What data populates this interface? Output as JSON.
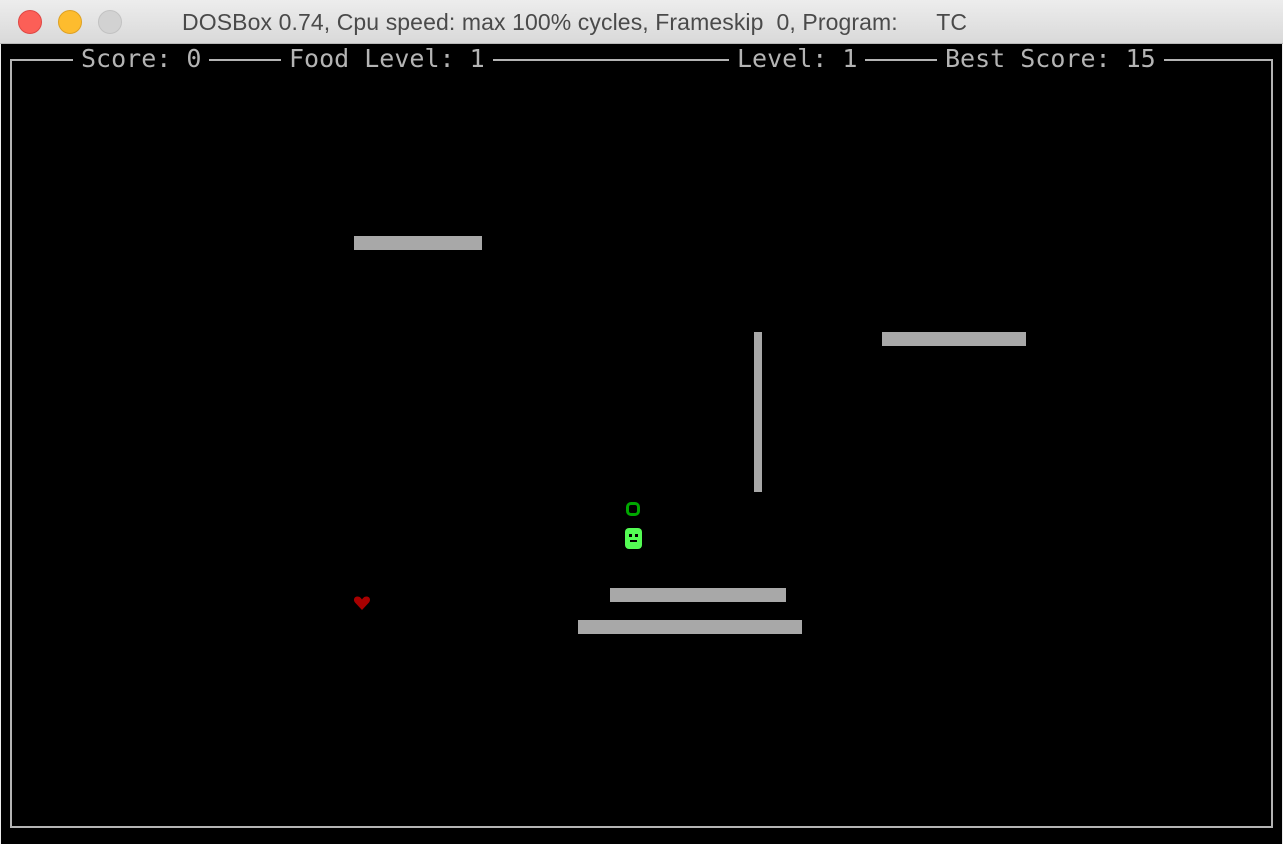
{
  "window": {
    "title": "DOSBox 0.74, Cpu speed: max 100% cycles, Frameskip  0, Program:      TC"
  },
  "hud": {
    "score": "Score: 0",
    "food_level": "Food Level: 1",
    "level": "Level: 1",
    "best_score": "Best Score: 15"
  },
  "game": {
    "walls": 5,
    "snake_head_icon": "smiley-face-icon",
    "snake_body_icon": "ring-icon",
    "food_icon": "heart-icon"
  },
  "colors": {
    "background": "#000000",
    "text": "#b4b4b4",
    "wall": "#a8a8a8",
    "snake_head": "#54fc54",
    "snake_body": "#00a800",
    "food": "#a80000",
    "close": "#fc5f57",
    "minimize": "#fdbc2e",
    "zoom": "#d2d2d2"
  }
}
